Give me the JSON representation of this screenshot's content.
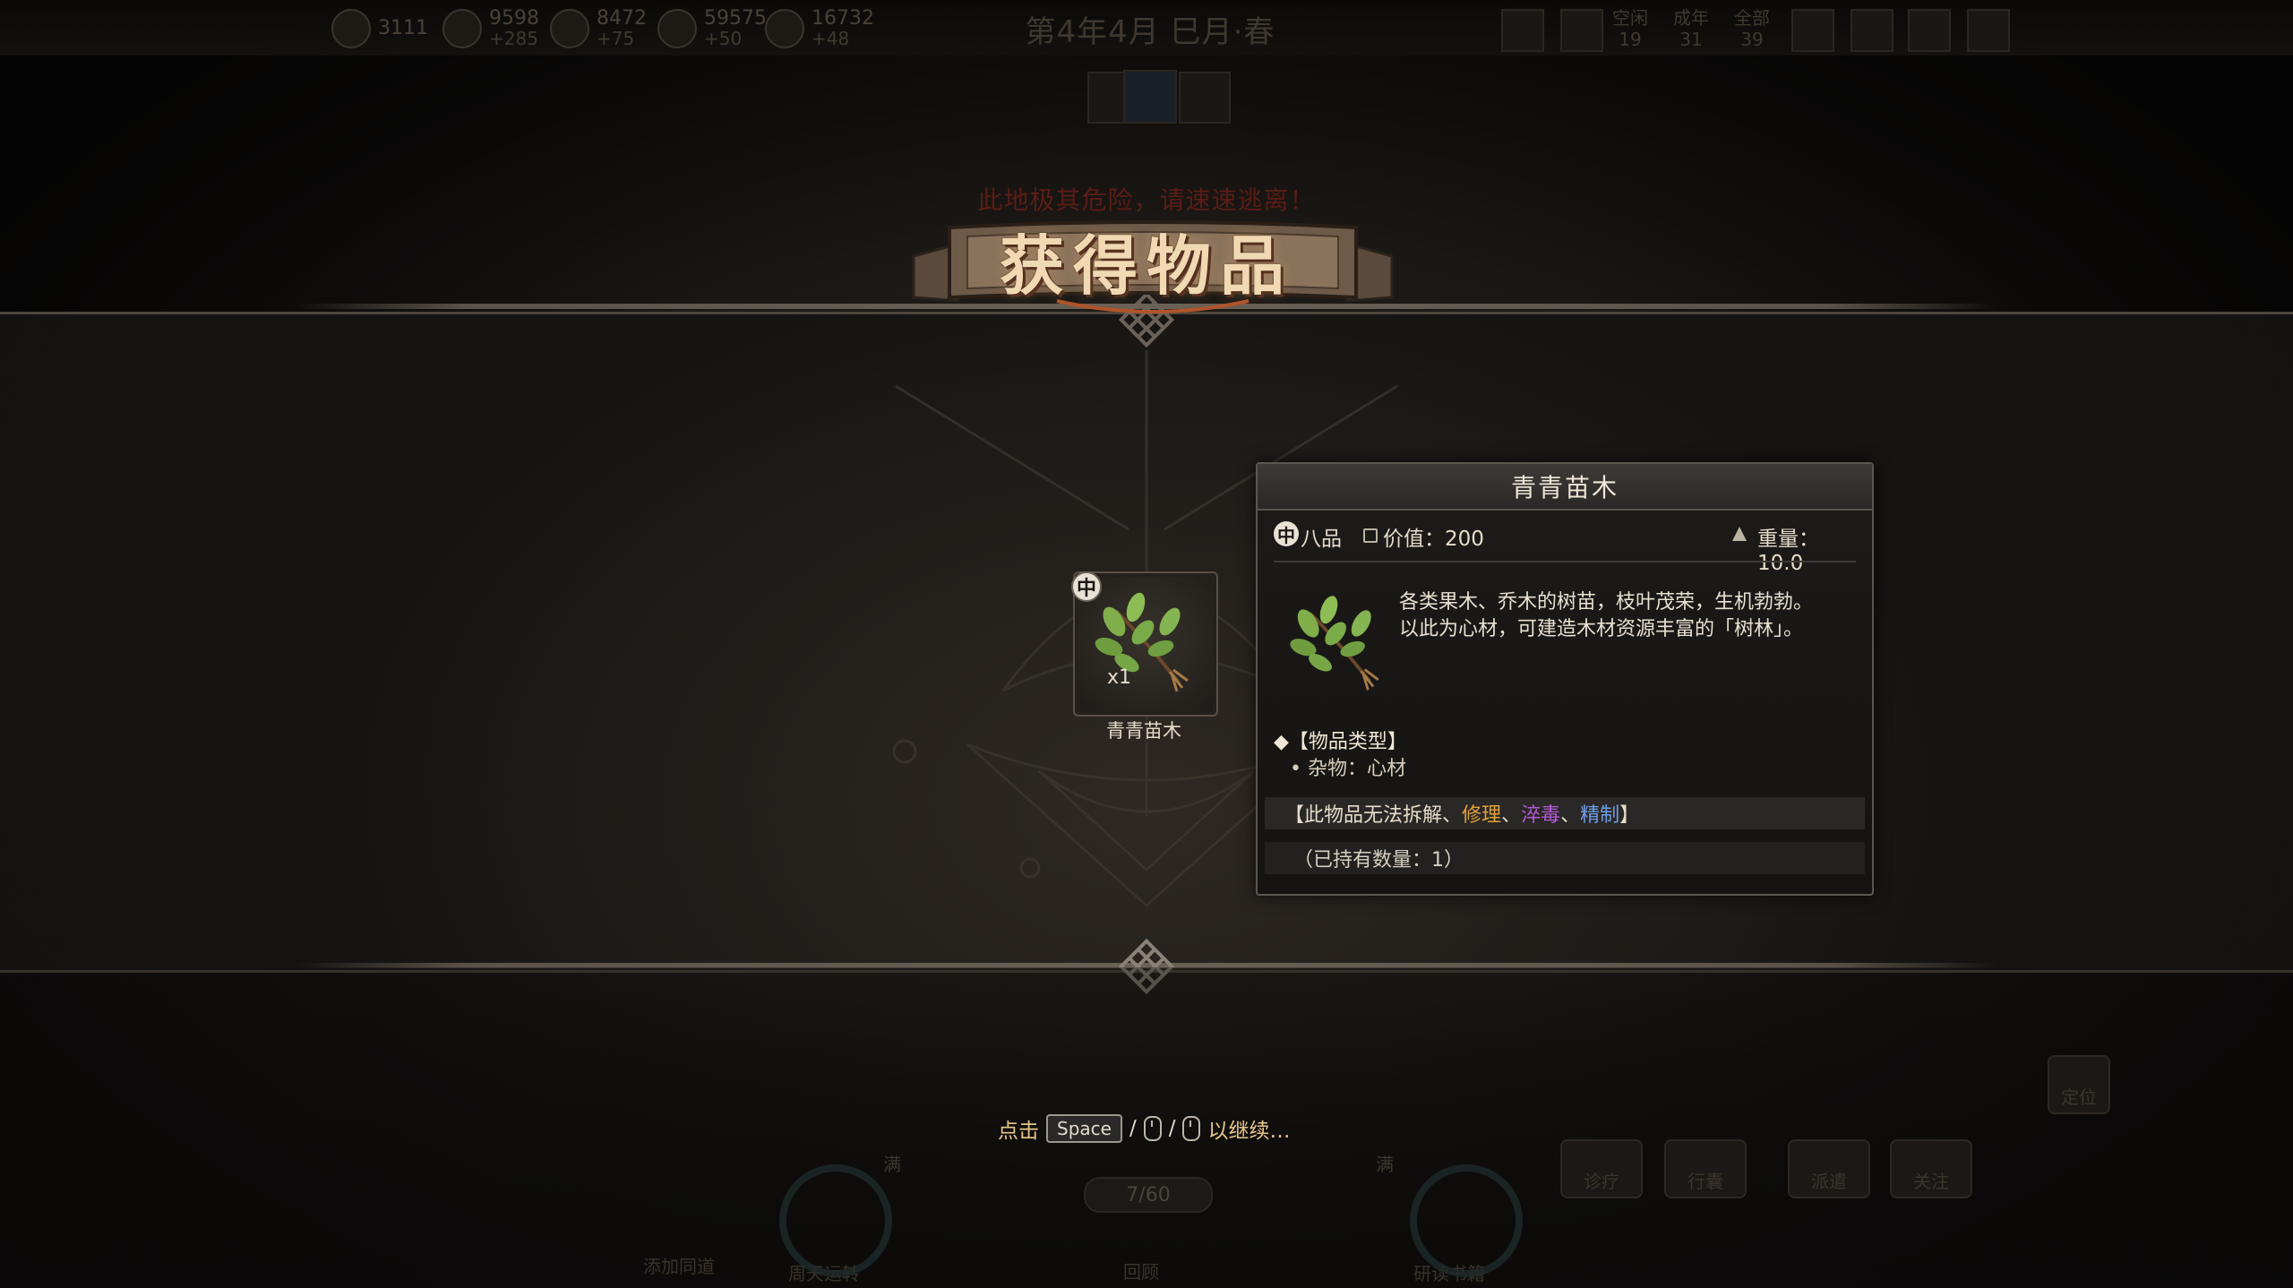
{
  "top_hud": {
    "resources": [
      {
        "icon": "resource-icon",
        "value": "3111",
        "delta": ""
      },
      {
        "icon": "resource-icon",
        "value": "9598",
        "delta": "+285"
      },
      {
        "icon": "resource-icon",
        "value": "8472",
        "delta": "+75"
      },
      {
        "icon": "resource-icon",
        "value": "59575",
        "delta": "+50"
      },
      {
        "icon": "resource-icon",
        "value": "16732",
        "delta": "+48"
      }
    ],
    "date": "第4年4月 巳月·春",
    "counts": [
      {
        "label": "空闲",
        "value": "19"
      },
      {
        "label": "成年",
        "value": "31"
      },
      {
        "label": "全部",
        "value": "39"
      }
    ]
  },
  "banner": {
    "warning": "此地极其危险，请速速逃离！",
    "title": "获得物品"
  },
  "item": {
    "grade_badge": "中",
    "quantity": "x1",
    "name": "青青苗木"
  },
  "tooltip": {
    "title": "青青苗木",
    "grade_badge": "中",
    "grade": "八品",
    "value_label": "价值：200",
    "weight_label": "重量：10.0",
    "description_line1": "各类果木、乔木的树苗，枝叶茂荣，生机勃勃。",
    "description_line2": "以此为心材，可建造木材资源丰富的「树林」。",
    "type_heading": "◆【物品类型】",
    "type_value": "• 杂物：心材",
    "cannot_prefix": "【此物品无法",
    "cannot_dismantle": "拆解",
    "sep": "、",
    "cannot_repair": "修理",
    "cannot_poison": "淬毒",
    "cannot_refine": "精制",
    "cannot_suffix": "】",
    "owned": "（已持有数量：1）"
  },
  "hint": {
    "prefix": "点击",
    "key": "Space",
    "slash": "/",
    "suffix": "以继续…"
  },
  "bottom_hud": {
    "buttons": [
      "诊疗",
      "行囊",
      "派遣",
      "关注",
      "定位"
    ],
    "labels": [
      "添加同道",
      "周天运转",
      "研读书籍",
      "回顾"
    ],
    "counter": "7/60",
    "full_marks": [
      "满",
      "满"
    ]
  },
  "colors": {
    "accent_gold": "#e8c68a",
    "repair": "#e0a23a",
    "poison": "#b45ad8",
    "refine": "#6f9ee8",
    "warning": "#5a1d16"
  }
}
